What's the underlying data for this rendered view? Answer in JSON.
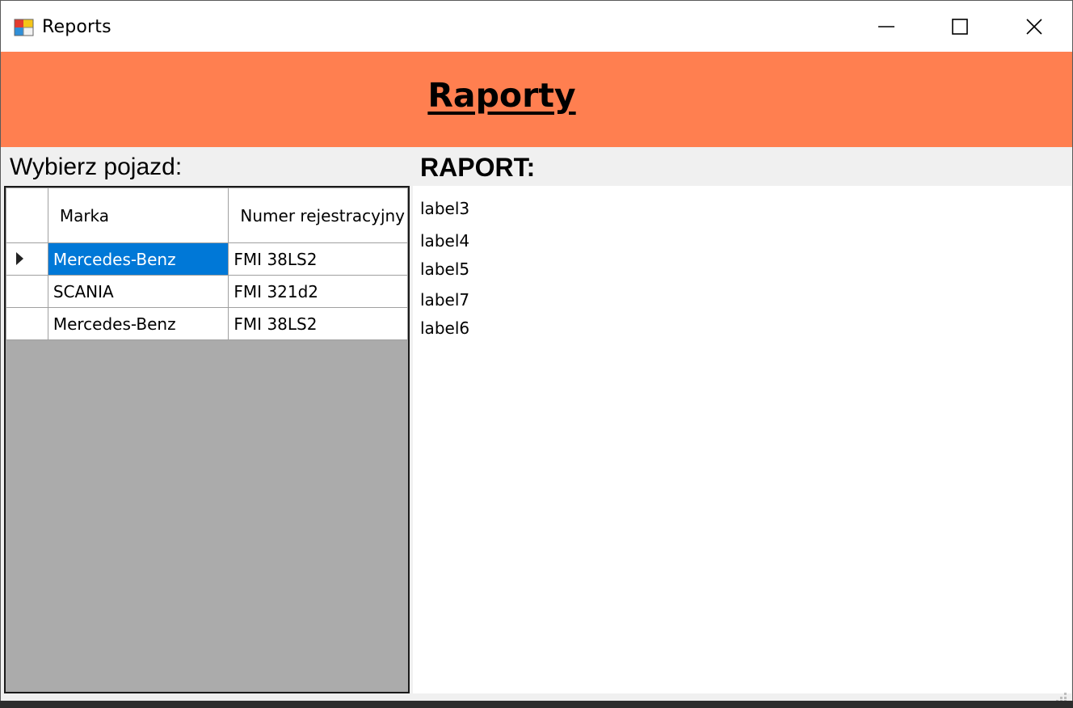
{
  "window": {
    "title": "Reports",
    "app_icon": "winforms-app-icon",
    "controls": {
      "minimize_icon": "minimize-icon",
      "maximize_icon": "maximize-icon",
      "close_icon": "close-icon"
    }
  },
  "header": {
    "title": "Raporty",
    "background_color": "#ff7f50"
  },
  "vehicle_panel": {
    "label": "Wybierz pojazd:",
    "columns": [
      "Marka",
      "Numer rejestracyjny"
    ],
    "rows": [
      {
        "marka": "Mercedes-Benz",
        "numer": "FMI 38LS2",
        "current": true,
        "selected_cell": "marka"
      },
      {
        "marka": "SCANIA",
        "numer": "FMI 321d2",
        "current": false
      },
      {
        "marka": "Mercedes-Benz",
        "numer": "FMI 38LS2",
        "current": false
      }
    ],
    "selection_color": "#0078d7"
  },
  "report_panel": {
    "label": "RAPORT:",
    "lines": [
      "label3",
      "label4",
      "label5",
      "label7",
      "label6"
    ]
  }
}
